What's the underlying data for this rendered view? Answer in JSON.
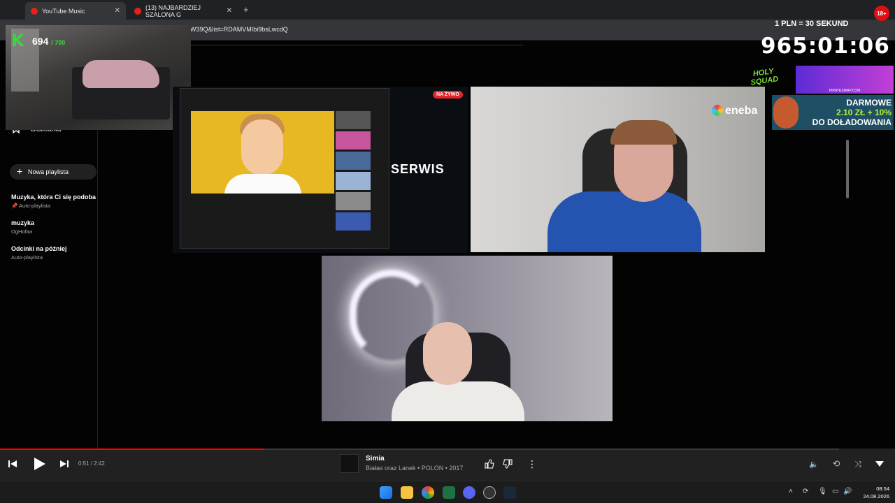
{
  "browser": {
    "tabs": [
      {
        "label": "YouTube Music",
        "active": true
      },
      {
        "label": "(13) NAJBARDZIEJ SZALONA G",
        "active": false
      }
    ],
    "url": "W39Q&list=RDAMVMIbi9bsLwcdQ"
  },
  "stream_overlay": {
    "counter_value": "694",
    "counter_max": "/ 700",
    "sub_rate": "1 PLN = 30 SEKUND",
    "timer": "965:01:06",
    "holy_squad": "HOLY SQUAD",
    "pirate_site": "PIRATESWAP.COM",
    "eneba": "eneba",
    "promo_line1": "DARMOWE",
    "promo_line2": "2.10 ZŁ + 10%",
    "promo_line3": "DO DOŁADOWANIA",
    "age_badge": "18+",
    "live_badge": "NA ŻYWO",
    "serwis": "SERWIS"
  },
  "sidebar": {
    "library_label": "Biblioteka",
    "new_playlist_label": "Nowa playlista",
    "playlists": [
      {
        "title": "Muzyka, która Ci się podoba",
        "subtitle": "Auto-playlista",
        "pinned": true
      },
      {
        "title": "muzyka",
        "subtitle": "OgHofaa",
        "pinned": false
      },
      {
        "title": "Odcinki na później",
        "subtitle": "Auto-playlista",
        "pinned": false
      }
    ]
  },
  "player": {
    "time": "0:51 / 2:42",
    "progress_fraction": 0.315,
    "song_title": "Simia",
    "song_meta": "Białas oraz Lanek • POLON • 2017"
  },
  "taskbar": {
    "time": "08:54",
    "date": "24.08.2026"
  },
  "colors": {
    "accent_red": "#ff0000",
    "green": "#3dd43d"
  }
}
